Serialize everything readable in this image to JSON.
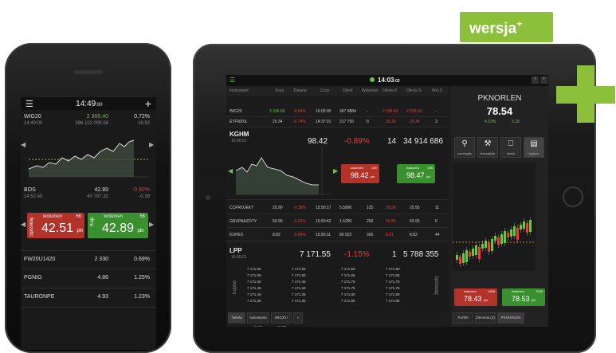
{
  "badge": {
    "text": "wersja",
    "sup": "+"
  },
  "phone": {
    "time": "14:49",
    "time_sec": ":00",
    "menu_icon": "menu-icon",
    "add_icon": "plus-icon",
    "index": {
      "name": "WIG20",
      "sub": "14:49:00",
      "price": "2 366.40",
      "pct": "0.72%",
      "vol": "396 102 008.58",
      "chg": "16.92"
    },
    "stock": {
      "name": "BOS",
      "sub": "14:52:45",
      "price": "42.89",
      "pct": "-0.90%",
      "vol": "40 787.32",
      "chg": "-0.39"
    },
    "sell": {
      "label": "wolumen",
      "qty": "66",
      "price": "42.51",
      "unit": "pln",
      "side": "Sprzedaj"
    },
    "buy": {
      "label": "wolumen",
      "qty": "56",
      "price": "42.89",
      "unit": "pln",
      "side": "Kup"
    },
    "list": [
      {
        "name": "FW20U1420",
        "price": "2 330",
        "pct": "0.69%"
      },
      {
        "name": "PGNIG",
        "price": "4.86",
        "pct": "1.25%"
      },
      {
        "name": "TAURONPE",
        "price": "4.93",
        "pct": "1.23%"
      }
    ]
  },
  "tablet": {
    "time": "14:03",
    "time_sec": ":02",
    "columns": [
      "Instrument",
      "Kurs",
      "Zmiana",
      "Czas",
      "Obrót",
      "Wolumen",
      "Oferta K",
      "Oferta S",
      "Wol.S"
    ],
    "rows_top": [
      {
        "name": "WIG20",
        "c": [
          "2 336.60",
          "-0.54%",
          "16:00:00",
          "367 9884",
          "-",
          "2 336.60",
          "2 336.60",
          "-"
        ]
      },
      {
        "name": "ETFW20L",
        "c": [
          "20.34",
          "-0.74%",
          "14:37:01",
          "217 755",
          "8",
          "20.26",
          "20.34",
          "3"
        ]
      }
    ],
    "kghm": {
      "name": "KGHM",
      "sub": "16:00:01",
      "price": "98.42",
      "pct": "-0.89%",
      "n": "14",
      "vol": "34 914 686"
    },
    "kghm_sell": {
      "label": "wolumen",
      "qty": "230",
      "price": "98.42",
      "unit": "pln"
    },
    "kghm_buy": {
      "label": "wolumen",
      "qty": "156",
      "price": "98.47",
      "unit": "pln"
    },
    "rows_mid": [
      {
        "name": "CCPROJEKT",
        "c": [
          "25.90",
          "-0.38%",
          "15:50:17",
          "5.5890",
          "125",
          "25.90",
          "25.95",
          "11"
        ]
      },
      {
        "name": "GRUPAAZOTY",
        "c": [
          "50.90",
          "-0.31%",
          "15:50:42",
          "1.5290",
          "200",
          "50.85",
          "50.90",
          "6"
        ]
      },
      {
        "name": "KOPEX",
        "c": [
          "8.82",
          "-0.90%",
          "15:50:11",
          "86 522",
          "320",
          "8.81",
          "8.82",
          "44"
        ]
      }
    ],
    "lpp": {
      "name": "LPP",
      "sub": "16:00:01",
      "price": "7 171.55",
      "pct": "-1.15%",
      "n": "1",
      "vol": "5 788 355"
    },
    "orderbook": [
      {
        "a": "7 171.56",
        "b": "7 171.55",
        "c": "7 171.60",
        "d": "7 171.60"
      },
      {
        "a": "7 171.55",
        "b": "7 171.50",
        "c": "7 171.65",
        "d": "7 171.65"
      },
      {
        "a": "7 171.50",
        "b": "7 171.45",
        "c": "7 171.70",
        "d": "7 171.70"
      },
      {
        "a": "7 171.45",
        "b": "7 171.40",
        "c": "7 171.75",
        "d": "7 171.75"
      },
      {
        "a": "7 171.40",
        "b": "7 171.35",
        "c": "7 171.80",
        "d": "7 171.80"
      },
      {
        "a": "7 171.35",
        "b": "7 171.30",
        "c": "7 171.85",
        "d": "7 171.85"
      }
    ],
    "ob_left": "Kupno",
    "ob_right": "Sprzedaj",
    "bottom_tabs": [
      "Tabela",
      "Notowania ciągłe",
      "WIG20 i mWIG",
      "+"
    ],
    "right": {
      "name": "PKNORLEN",
      "price": "78.54",
      "pct": "4.23%",
      "chg": "3.18",
      "buttons": [
        {
          "icon": "magnifier-icon",
          "label": "szczegóły"
        },
        {
          "icon": "gavel-icon",
          "label": "transakcje"
        },
        {
          "icon": "candle-icon",
          "label": "oferty"
        },
        {
          "icon": "chart-icon",
          "label": "wykres"
        }
      ],
      "sell": {
        "label": "wolumen",
        "qty": "1838",
        "price": "78.43",
        "unit": "pln"
      },
      "buy": {
        "label": "wolumen",
        "qty": "7046",
        "price": "78.53",
        "unit": "pln"
      },
      "tabs": [
        "Portfel",
        "Zlecenia (2)",
        "PKNORLEN"
      ]
    }
  },
  "colors": {
    "up": "#6cc24a",
    "down": "#e04040",
    "accent": "#8cbf3a"
  }
}
